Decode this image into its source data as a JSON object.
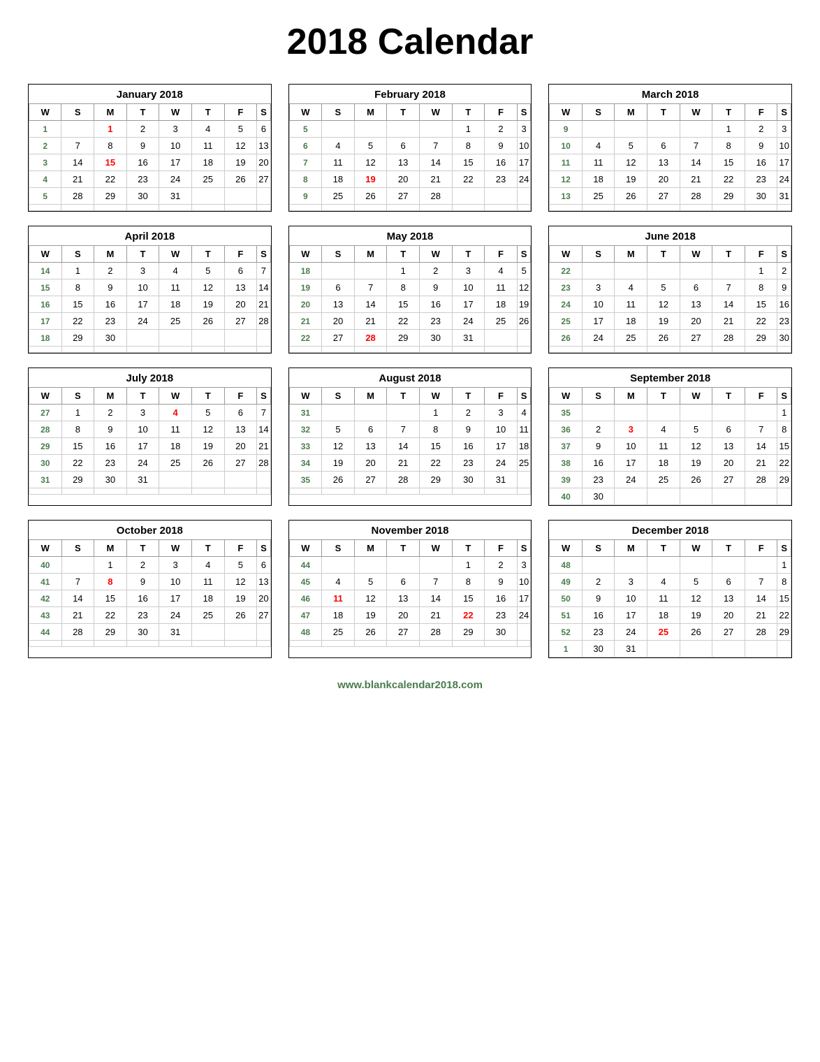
{
  "title": "2018 Calendar",
  "footer": "www.blankcalendar2018.com",
  "months": [
    {
      "name": "January 2018",
      "weeks": [
        {
          "wn": "1",
          "days": [
            "",
            "1",
            "2",
            "3",
            "4",
            "5",
            "6"
          ],
          "red": [
            1
          ]
        },
        {
          "wn": "2",
          "days": [
            "7",
            "8",
            "9",
            "10",
            "11",
            "12",
            "13"
          ],
          "red": []
        },
        {
          "wn": "3",
          "days": [
            "14",
            "15",
            "16",
            "17",
            "18",
            "19",
            "20"
          ],
          "red": [
            15
          ]
        },
        {
          "wn": "4",
          "days": [
            "21",
            "22",
            "23",
            "24",
            "25",
            "26",
            "27"
          ],
          "red": []
        },
        {
          "wn": "5",
          "days": [
            "28",
            "29",
            "30",
            "31",
            "",
            "",
            ""
          ],
          "red": []
        },
        {
          "wn": "",
          "days": [
            "",
            "",
            "",
            "",
            "",
            "",
            ""
          ],
          "red": []
        }
      ]
    },
    {
      "name": "February 2018",
      "weeks": [
        {
          "wn": "5",
          "days": [
            "",
            "",
            "",
            "",
            "1",
            "2",
            "3"
          ],
          "red": []
        },
        {
          "wn": "6",
          "days": [
            "4",
            "5",
            "6",
            "7",
            "8",
            "9",
            "10"
          ],
          "red": []
        },
        {
          "wn": "7",
          "days": [
            "11",
            "12",
            "13",
            "14",
            "15",
            "16",
            "17"
          ],
          "red": []
        },
        {
          "wn": "8",
          "days": [
            "18",
            "19",
            "20",
            "21",
            "22",
            "23",
            "24"
          ],
          "red": [
            19
          ]
        },
        {
          "wn": "9",
          "days": [
            "25",
            "26",
            "27",
            "28",
            "",
            "",
            ""
          ],
          "red": []
        },
        {
          "wn": "",
          "days": [
            "",
            "",
            "",
            "",
            "",
            "",
            ""
          ],
          "red": []
        }
      ]
    },
    {
      "name": "March 2018",
      "weeks": [
        {
          "wn": "9",
          "days": [
            "",
            "",
            "",
            "",
            "1",
            "2",
            "3"
          ],
          "red": []
        },
        {
          "wn": "10",
          "days": [
            "4",
            "5",
            "6",
            "7",
            "8",
            "9",
            "10"
          ],
          "red": []
        },
        {
          "wn": "11",
          "days": [
            "11",
            "12",
            "13",
            "14",
            "15",
            "16",
            "17"
          ],
          "red": []
        },
        {
          "wn": "12",
          "days": [
            "18",
            "19",
            "20",
            "21",
            "22",
            "23",
            "24"
          ],
          "red": []
        },
        {
          "wn": "13",
          "days": [
            "25",
            "26",
            "27",
            "28",
            "29",
            "30",
            "31"
          ],
          "red": []
        },
        {
          "wn": "",
          "days": [
            "",
            "",
            "",
            "",
            "",
            "",
            ""
          ],
          "red": []
        }
      ]
    },
    {
      "name": "April 2018",
      "weeks": [
        {
          "wn": "14",
          "days": [
            "1",
            "2",
            "3",
            "4",
            "5",
            "6",
            "7"
          ],
          "red": []
        },
        {
          "wn": "15",
          "days": [
            "8",
            "9",
            "10",
            "11",
            "12",
            "13",
            "14"
          ],
          "red": []
        },
        {
          "wn": "16",
          "days": [
            "15",
            "16",
            "17",
            "18",
            "19",
            "20",
            "21"
          ],
          "red": []
        },
        {
          "wn": "17",
          "days": [
            "22",
            "23",
            "24",
            "25",
            "26",
            "27",
            "28"
          ],
          "red": []
        },
        {
          "wn": "18",
          "days": [
            "29",
            "30",
            "",
            "",
            "",
            "",
            ""
          ],
          "red": []
        },
        {
          "wn": "",
          "days": [
            "",
            "",
            "",
            "",
            "",
            "",
            ""
          ],
          "red": []
        }
      ]
    },
    {
      "name": "May 2018",
      "weeks": [
        {
          "wn": "18",
          "days": [
            "",
            "",
            "1",
            "2",
            "3",
            "4",
            "5"
          ],
          "red": []
        },
        {
          "wn": "19",
          "days": [
            "6",
            "7",
            "8",
            "9",
            "10",
            "11",
            "12"
          ],
          "red": []
        },
        {
          "wn": "20",
          "days": [
            "13",
            "14",
            "15",
            "16",
            "17",
            "18",
            "19"
          ],
          "red": []
        },
        {
          "wn": "21",
          "days": [
            "20",
            "21",
            "22",
            "23",
            "24",
            "25",
            "26"
          ],
          "red": []
        },
        {
          "wn": "22",
          "days": [
            "27",
            "28",
            "29",
            "30",
            "31",
            "",
            ""
          ],
          "red": [
            28
          ]
        },
        {
          "wn": "",
          "days": [
            "",
            "",
            "",
            "",
            "",
            "",
            ""
          ],
          "red": []
        }
      ]
    },
    {
      "name": "June 2018",
      "weeks": [
        {
          "wn": "22",
          "days": [
            "",
            "",
            "",
            "",
            "",
            "1",
            "2"
          ],
          "red": []
        },
        {
          "wn": "23",
          "days": [
            "3",
            "4",
            "5",
            "6",
            "7",
            "8",
            "9"
          ],
          "red": []
        },
        {
          "wn": "24",
          "days": [
            "10",
            "11",
            "12",
            "13",
            "14",
            "15",
            "16"
          ],
          "red": []
        },
        {
          "wn": "25",
          "days": [
            "17",
            "18",
            "19",
            "20",
            "21",
            "22",
            "23"
          ],
          "red": []
        },
        {
          "wn": "26",
          "days": [
            "24",
            "25",
            "26",
            "27",
            "28",
            "29",
            "30"
          ],
          "red": []
        },
        {
          "wn": "",
          "days": [
            "",
            "",
            "",
            "",
            "",
            "",
            ""
          ],
          "red": []
        }
      ]
    },
    {
      "name": "July 2018",
      "weeks": [
        {
          "wn": "27",
          "days": [
            "1",
            "2",
            "3",
            "4",
            "5",
            "6",
            "7"
          ],
          "red": [
            4
          ]
        },
        {
          "wn": "28",
          "days": [
            "8",
            "9",
            "10",
            "11",
            "12",
            "13",
            "14"
          ],
          "red": []
        },
        {
          "wn": "29",
          "days": [
            "15",
            "16",
            "17",
            "18",
            "19",
            "20",
            "21"
          ],
          "red": []
        },
        {
          "wn": "30",
          "days": [
            "22",
            "23",
            "24",
            "25",
            "26",
            "27",
            "28"
          ],
          "red": []
        },
        {
          "wn": "31",
          "days": [
            "29",
            "30",
            "31",
            "",
            "",
            "",
            ""
          ],
          "red": []
        },
        {
          "wn": "",
          "days": [
            "",
            "",
            "",
            "",
            "",
            "",
            ""
          ],
          "red": []
        }
      ]
    },
    {
      "name": "August 2018",
      "weeks": [
        {
          "wn": "31",
          "days": [
            "",
            "",
            "",
            "1",
            "2",
            "3",
            "4"
          ],
          "red": []
        },
        {
          "wn": "32",
          "days": [
            "5",
            "6",
            "7",
            "8",
            "9",
            "10",
            "11"
          ],
          "red": []
        },
        {
          "wn": "33",
          "days": [
            "12",
            "13",
            "14",
            "15",
            "16",
            "17",
            "18"
          ],
          "red": []
        },
        {
          "wn": "34",
          "days": [
            "19",
            "20",
            "21",
            "22",
            "23",
            "24",
            "25"
          ],
          "red": []
        },
        {
          "wn": "35",
          "days": [
            "26",
            "27",
            "28",
            "29",
            "30",
            "31",
            ""
          ],
          "red": []
        },
        {
          "wn": "",
          "days": [
            "",
            "",
            "",
            "",
            "",
            "",
            ""
          ],
          "red": []
        }
      ]
    },
    {
      "name": "September 2018",
      "weeks": [
        {
          "wn": "35",
          "days": [
            "",
            "",
            "",
            "",
            "",
            "",
            "1"
          ],
          "red": []
        },
        {
          "wn": "36",
          "days": [
            "2",
            "3",
            "4",
            "5",
            "6",
            "7",
            "8"
          ],
          "red": [
            3
          ]
        },
        {
          "wn": "37",
          "days": [
            "9",
            "10",
            "11",
            "12",
            "13",
            "14",
            "15"
          ],
          "red": []
        },
        {
          "wn": "38",
          "days": [
            "16",
            "17",
            "18",
            "19",
            "20",
            "21",
            "22"
          ],
          "red": []
        },
        {
          "wn": "39",
          "days": [
            "23",
            "24",
            "25",
            "26",
            "27",
            "28",
            "29"
          ],
          "red": []
        },
        {
          "wn": "40",
          "days": [
            "30",
            "",
            "",
            "",
            "",
            "",
            ""
          ],
          "red": []
        }
      ]
    },
    {
      "name": "October 2018",
      "weeks": [
        {
          "wn": "40",
          "days": [
            "",
            "1",
            "2",
            "3",
            "4",
            "5",
            "6"
          ],
          "red": []
        },
        {
          "wn": "41",
          "days": [
            "7",
            "8",
            "9",
            "10",
            "11",
            "12",
            "13"
          ],
          "red": [
            8
          ]
        },
        {
          "wn": "42",
          "days": [
            "14",
            "15",
            "16",
            "17",
            "18",
            "19",
            "20"
          ],
          "red": []
        },
        {
          "wn": "43",
          "days": [
            "21",
            "22",
            "23",
            "24",
            "25",
            "26",
            "27"
          ],
          "red": []
        },
        {
          "wn": "44",
          "days": [
            "28",
            "29",
            "30",
            "31",
            "",
            "",
            ""
          ],
          "red": []
        },
        {
          "wn": "",
          "days": [
            "",
            "",
            "",
            "",
            "",
            "",
            ""
          ],
          "red": []
        }
      ]
    },
    {
      "name": "November 2018",
      "weeks": [
        {
          "wn": "44",
          "days": [
            "",
            "",
            "",
            "",
            "1",
            "2",
            "3"
          ],
          "red": []
        },
        {
          "wn": "45",
          "days": [
            "4",
            "5",
            "6",
            "7",
            "8",
            "9",
            "10"
          ],
          "red": []
        },
        {
          "wn": "46",
          "days": [
            "11",
            "12",
            "13",
            "14",
            "15",
            "16",
            "17"
          ],
          "red": [
            11
          ]
        },
        {
          "wn": "47",
          "days": [
            "18",
            "19",
            "20",
            "21",
            "22",
            "23",
            "24"
          ],
          "red": [
            22
          ]
        },
        {
          "wn": "48",
          "days": [
            "25",
            "26",
            "27",
            "28",
            "29",
            "30",
            ""
          ],
          "red": []
        },
        {
          "wn": "",
          "days": [
            "",
            "",
            "",
            "",
            "",
            "",
            ""
          ],
          "red": []
        }
      ]
    },
    {
      "name": "December 2018",
      "weeks": [
        {
          "wn": "48",
          "days": [
            "",
            "",
            "",
            "",
            "",
            "",
            "1"
          ],
          "red": []
        },
        {
          "wn": "49",
          "days": [
            "2",
            "3",
            "4",
            "5",
            "6",
            "7",
            "8"
          ],
          "red": []
        },
        {
          "wn": "50",
          "days": [
            "9",
            "10",
            "11",
            "12",
            "13",
            "14",
            "15"
          ],
          "red": []
        },
        {
          "wn": "51",
          "days": [
            "16",
            "17",
            "18",
            "19",
            "20",
            "21",
            "22"
          ],
          "red": []
        },
        {
          "wn": "52",
          "days": [
            "23",
            "24",
            "25",
            "26",
            "27",
            "28",
            "29"
          ],
          "red": [
            25
          ]
        },
        {
          "wn": "1",
          "days": [
            "30",
            "31",
            "",
            "",
            "",
            "",
            ""
          ],
          "red": []
        }
      ]
    }
  ],
  "headers": [
    "W",
    "S",
    "M",
    "T",
    "W",
    "T",
    "F",
    "S"
  ]
}
